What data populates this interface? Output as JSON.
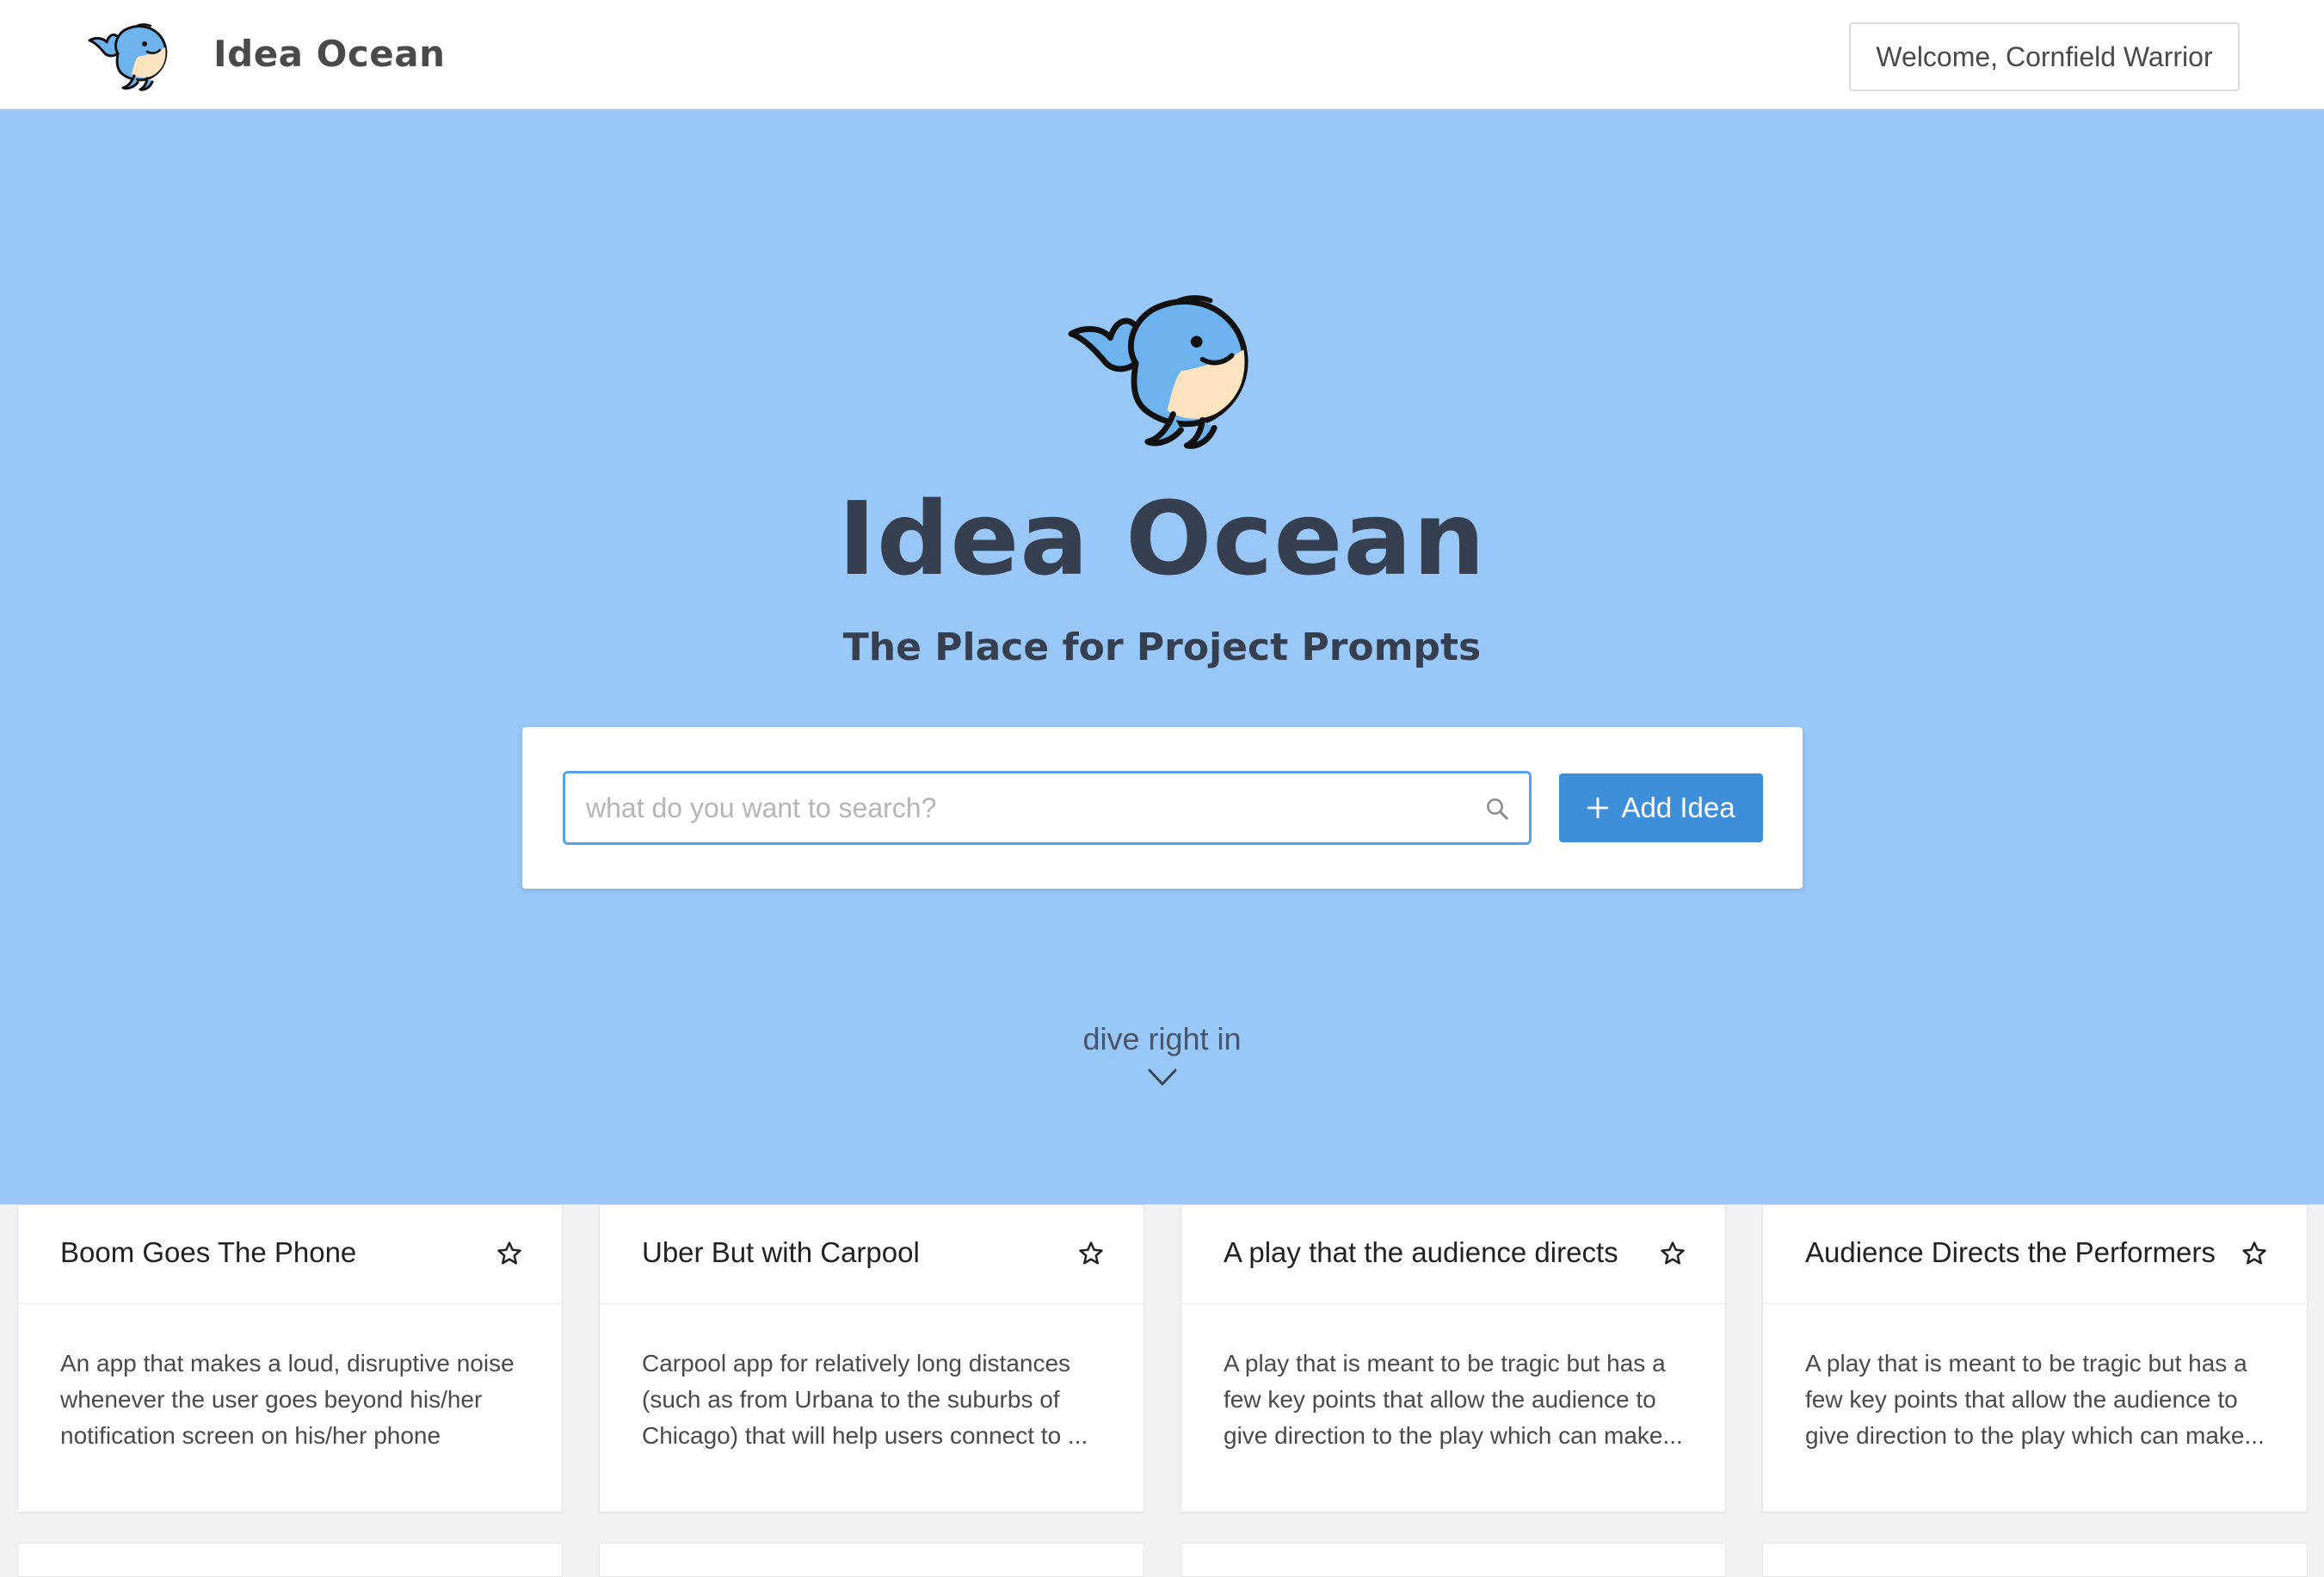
{
  "navbar": {
    "brand": "Idea Ocean",
    "welcome": "Welcome, Cornfield Warrior",
    "logo_icon": "whale-icon"
  },
  "hero": {
    "title": "Idea Ocean",
    "subtitle": "The Place for Project Prompts",
    "logo_icon": "whale-icon",
    "search_placeholder": "what do you want to search?",
    "search_value": "",
    "add_label": "Add Idea",
    "dive_label": "dive right in"
  },
  "cards": [
    {
      "title": "Boom Goes The Phone",
      "body": "An app that makes a loud, disruptive noise whenever the user goes beyond his/her notification screen on his/her phone"
    },
    {
      "title": "Uber But with Carpool",
      "body": "Carpool app for relatively long distances (such as from Urbana to the suburbs of Chicago) that will help users connect to ..."
    },
    {
      "title": "A play that the audience directs",
      "body": "A play that is meant to be tragic but has a few key points that allow the audience to give direction to the play which can make..."
    },
    {
      "title": "Audience Directs the Performers",
      "body": "A play that is meant to be tragic but has a few key points that allow the audience to give direction to the play which can make..."
    }
  ],
  "colors": {
    "hero_bg": "#98c7f8",
    "primary": "#3e8ed9",
    "search_border": "#56a2ea",
    "title_text": "#363f4f",
    "whale_body": "#6fb3ee",
    "whale_belly": "#fde3c0"
  }
}
